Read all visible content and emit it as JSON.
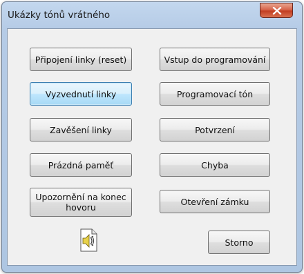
{
  "window": {
    "title": "Ukázky tónů vrátného",
    "close_icon": "close-x-icon"
  },
  "buttons": {
    "pripojeni": "Připojení linky (reset)",
    "vyzvednuti": "Vyzvednutí linky",
    "zaveseni": "Zavěšení linky",
    "prazdna_pamet": "Prázdná paměť",
    "upozorneni": "Upozornění na konec hovoru",
    "vstup": "Vstup do programování",
    "programovaci_ton": "Programovací tón",
    "potvrzeni": "Potvrzení",
    "chyba": "Chyba",
    "otevreni_zamku": "Otevření zámku",
    "storno": "Storno"
  },
  "icons": {
    "sound_file": "speaker-document-icon"
  },
  "colors": {
    "title_bar": "#b5cbe6",
    "dialog_background": "#f0f0f0",
    "close_button": "#c94a2c",
    "focused_button": "#bee6fd"
  }
}
